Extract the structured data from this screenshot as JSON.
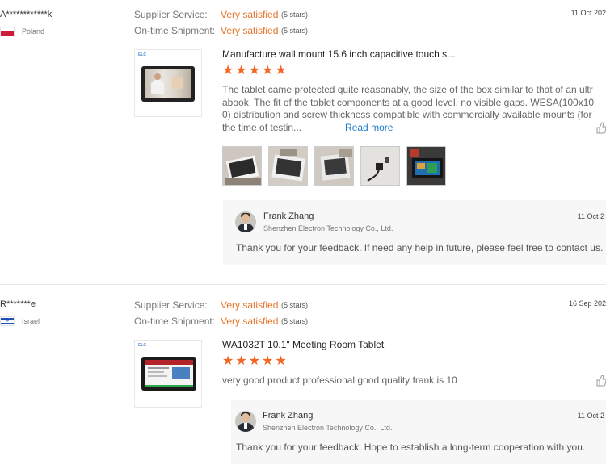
{
  "reviews": [
    {
      "user": "A************k",
      "country": "Poland",
      "flag_icon": "poland-flag-icon",
      "date": "11 Oct 202",
      "supplier_service_label": "Supplier Service:",
      "supplier_service_value": "Very satisfied",
      "supplier_service_stars": "(5 stars)",
      "shipment_label": "On-time Shipment:",
      "shipment_value": "Very satisfied",
      "shipment_stars": "(5 stars)",
      "product_logo": "ELC",
      "product_title": "Manufacture wall mount 15.6 inch capacitive touch s...",
      "rating": 5,
      "stars_text": "★★★★★",
      "text": "The tablet came protected quite reasonably, the size of the box similar to that of an ultrabook. The fit of the tablet components at a good level, no visible gaps. WESA(100x100) distribution and screw thickness compatible with commercially available mounts (for the time of testin...",
      "read_more": "Read more",
      "photo_count": 5,
      "reply": {
        "name": "Frank Zhang",
        "company": "Shenzhen Electron Technology Co., Ltd.",
        "date": "11 Oct 2",
        "text": "Thank you for your feedback. If need any help in future, please feel free to contact us."
      }
    },
    {
      "user": "R*******e",
      "country": "Israel",
      "flag_icon": "israel-flag-icon",
      "date": "16 Sep 202",
      "supplier_service_label": "Supplier Service:",
      "supplier_service_value": "Very satisfied",
      "supplier_service_stars": "(5 stars)",
      "shipment_label": "On-time Shipment:",
      "shipment_value": "Very satisfied",
      "shipment_stars": "(5 stars)",
      "product_logo": "ELC",
      "product_title": "WA1032T 10.1\" Meeting Room Tablet",
      "rating": 5,
      "stars_text": "★★★★★",
      "text": "very good product professional good quality frank is 10",
      "reply": {
        "name": "Frank Zhang",
        "company": "Shenzhen Electron Technology Co., Ltd.",
        "date": "11 Oct 2",
        "text": "Thank you for your feedback. Hope to establish a long-term cooperation with you."
      }
    }
  ],
  "colors": {
    "accent_orange": "#e8742a",
    "star_orange": "#f26522",
    "link_blue": "#1e7bc8",
    "reply_bg": "#f7f7f7"
  }
}
